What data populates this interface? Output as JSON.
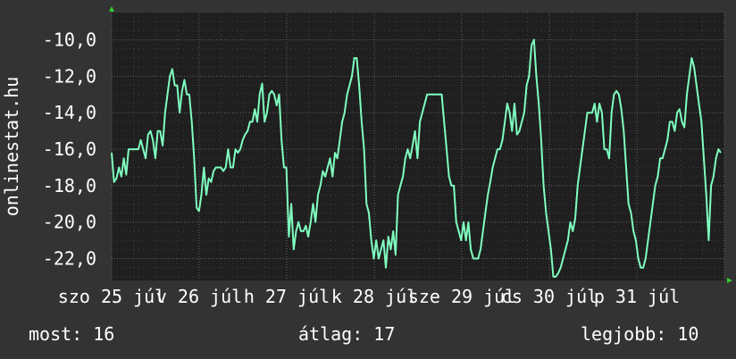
{
  "colors": {
    "background": "#333333",
    "plot_background": "#1f1f1f",
    "grid": "#6a6a6a",
    "line": "#7fffbf",
    "axis_arrow": "#33cc33",
    "text": "#ffffff"
  },
  "chart_data": {
    "type": "line",
    "ylabel": "onlinestat.hu",
    "xlabel": "",
    "title": "",
    "ylim": [
      -23.2,
      -8.5
    ],
    "y_ticks": [
      -10,
      -12,
      -14,
      -16,
      -18,
      -20,
      -22
    ],
    "y_tick_labels": [
      "-10,0",
      "-12,0",
      "-14,0",
      "-16,0",
      "-18,0",
      "-20,0",
      "-22,0"
    ],
    "x_tick_labels": [
      "szo 25 júl",
      "v 26 júl",
      "h 27 júl",
      "k 28 júl",
      "sze 29 júl",
      "cs 30 júl",
      "p 31 júl"
    ],
    "grid": true,
    "series": [
      {
        "values": [
          -16.2,
          -17.8,
          -17.6,
          -17.0,
          -17.5,
          -16.5,
          -17.4,
          -16.0,
          -16.0,
          -16.0,
          -16.0,
          -16.0,
          -15.5,
          -16.0,
          -16.5,
          -15.2,
          -15.0,
          -15.5,
          -16.5,
          -15.0,
          -15.0,
          -15.8,
          -14.0,
          -13.0,
          -12.0,
          -11.6,
          -12.5,
          -12.5,
          -14.0,
          -12.8,
          -12.2,
          -13.0,
          -13.0,
          -14.5,
          -16.5,
          -19.2,
          -19.4,
          -18.5,
          -17.0,
          -18.5,
          -17.6,
          -17.8,
          -17.2,
          -17.0,
          -17.0,
          -17.0,
          -17.2,
          -17.0,
          -16.0,
          -17.0,
          -17.0,
          -16.0,
          -16.2,
          -16.0,
          -15.5,
          -15.2,
          -15.0,
          -14.5,
          -14.5,
          -13.8,
          -14.5,
          -13.0,
          -12.4,
          -14.5,
          -14.0,
          -13.0,
          -12.8,
          -13.0,
          -13.6,
          -13.0,
          -15.5,
          -17.0,
          -17.0,
          -20.8,
          -19.0,
          -21.5,
          -20.5,
          -20.0,
          -20.5,
          -20.5,
          -20.2,
          -20.8,
          -20.0,
          -19.0,
          -20.0,
          -18.5,
          -18.0,
          -17.2,
          -17.5,
          -17.0,
          -16.5,
          -17.5,
          -16.2,
          -16.5,
          -15.5,
          -14.5,
          -14.0,
          -13.0,
          -12.5,
          -12.0,
          -11.0,
          -11.0,
          -12.5,
          -14.5,
          -16.0,
          -19.0,
          -19.5,
          -21.0,
          -22.0,
          -21.0,
          -22.0,
          -21.5,
          -21.0,
          -22.5,
          -20.8,
          -21.5,
          -20.5,
          -21.8,
          -18.5,
          -18.0,
          -17.5,
          -16.5,
          -16.0,
          -16.5,
          -15.8,
          -15.0,
          -16.5,
          -14.5,
          -14.0,
          -13.5,
          -13.0,
          -13.0,
          -13.0,
          -13.0,
          -13.0,
          -13.0,
          -13.0,
          -14.5,
          -16.0,
          -17.5,
          -18.0,
          -18.0,
          -20.0,
          -20.5,
          -21.0,
          -20.0,
          -21.0,
          -20.0,
          -21.5,
          -22.0,
          -22.0,
          -22.0,
          -21.5,
          -20.5,
          -19.5,
          -18.5,
          -17.8,
          -17.0,
          -16.5,
          -16.0,
          -16.0,
          -15.5,
          -14.5,
          -13.5,
          -14.0,
          -15.0,
          -13.5,
          -15.2,
          -15.0,
          -14.5,
          -14.0,
          -12.5,
          -12.0,
          -10.3,
          -10.0,
          -12.0,
          -13.5,
          -15.5,
          -18.0,
          -19.5,
          -20.5,
          -21.5,
          -23.0,
          -23.0,
          -22.8,
          -22.5,
          -22.0,
          -21.5,
          -21.0,
          -20.0,
          -20.5,
          -19.8,
          -18.0,
          -17.0,
          -16.0,
          -15.0,
          -14.0,
          -14.0,
          -14.0,
          -13.5,
          -14.5,
          -13.5,
          -14.0,
          -16.0,
          -16.0,
          -16.5,
          -14.0,
          -13.0,
          -12.8,
          -13.0,
          -13.8,
          -15.0,
          -17.0,
          -19.0,
          -19.5,
          -20.5,
          -21.0,
          -22.0,
          -22.5,
          -22.5,
          -22.0,
          -21.0,
          -20.0,
          -19.0,
          -18.0,
          -17.5,
          -16.5,
          -16.5,
          -16.0,
          -15.5,
          -14.5,
          -14.5,
          -15.0,
          -14.0,
          -13.8,
          -14.5,
          -14.8,
          -13.0,
          -12.0,
          -11.0,
          -11.5,
          -12.5,
          -13.5,
          -14.5,
          -16.5,
          -18.5,
          -21.0,
          -18.0,
          -17.5,
          -16.5,
          -16.0,
          -16.2
        ]
      }
    ]
  },
  "stats": {
    "most": "most: 16",
    "atlag": "átlag: 17",
    "legjobb": "legjobb: 10"
  }
}
